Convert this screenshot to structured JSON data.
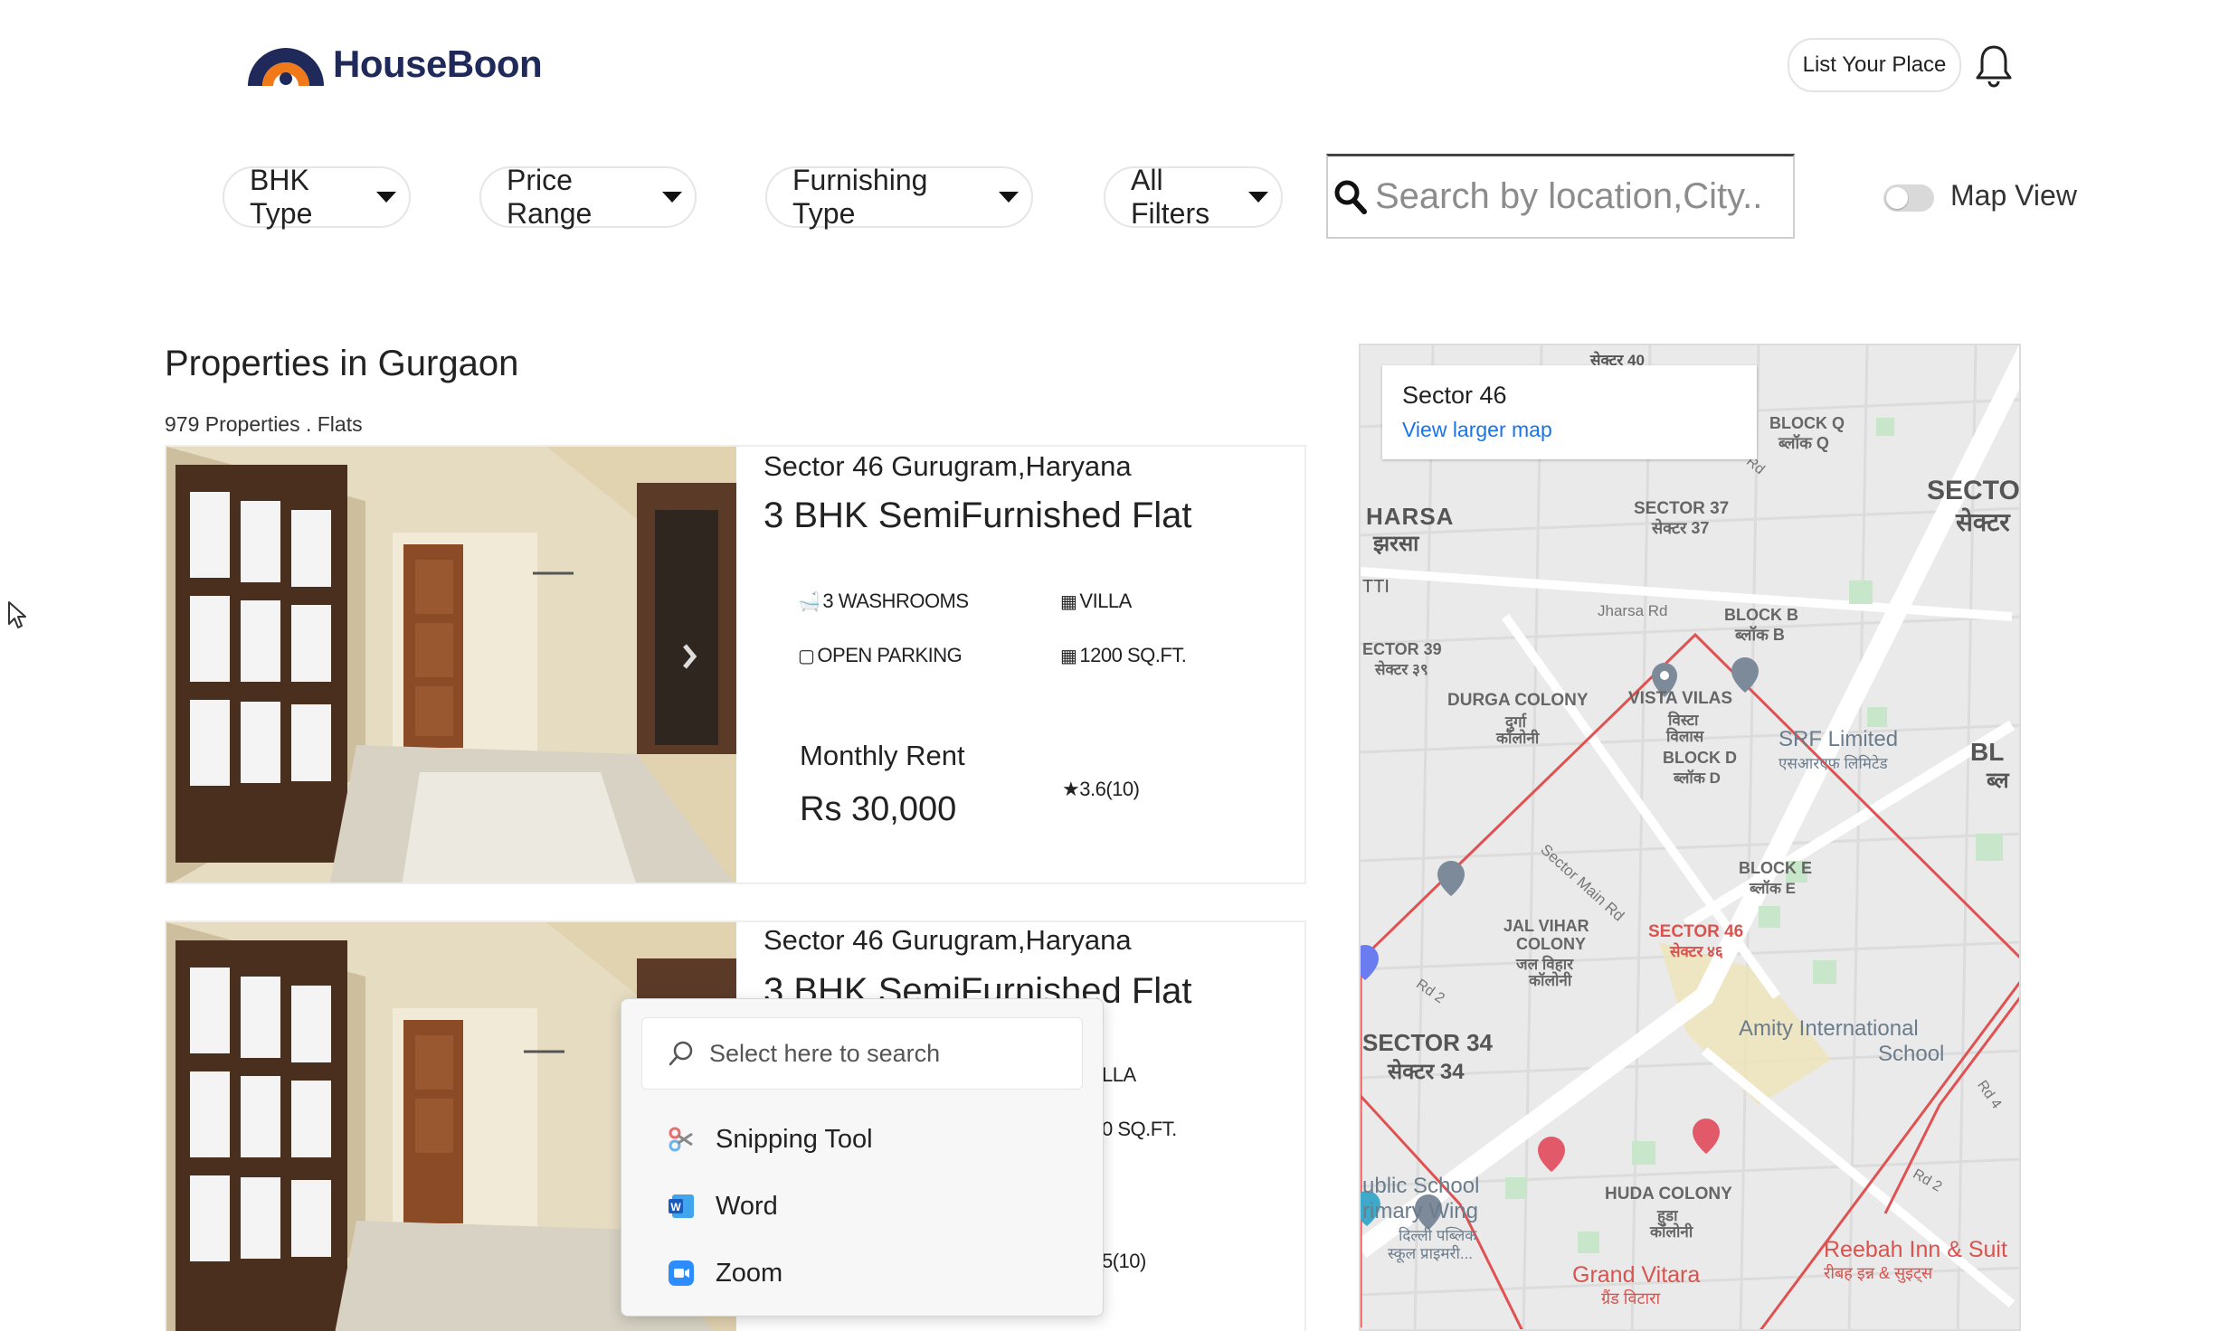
{
  "brand": {
    "name": "HouseBoon"
  },
  "header": {
    "list_place": "List Your Place"
  },
  "filters": [
    {
      "label": "BHK Type"
    },
    {
      "label": "Price Range"
    },
    {
      "label": "Furnishing Type"
    },
    {
      "label": "All Filters"
    }
  ],
  "search": {
    "placeholder": "Search by location,City.."
  },
  "map_toggle": {
    "label": "Map View",
    "enabled": false
  },
  "listing": {
    "title": "Properties in Gurgaon",
    "subtitle": "979 Properties . Flats"
  },
  "cards": [
    {
      "location": "Sector 46 Gurugram,Haryana",
      "title": "3 BHK SemiFurnished Flat",
      "features": [
        "3 WASHROOMS",
        "VILLA",
        "OPEN PARKING",
        "1200 SQ.FT."
      ],
      "rent_label": "Monthly Rent",
      "rent": "Rs 30,000",
      "rating": "3.6(10)"
    },
    {
      "location": "Sector 46 Gurugram,Haryana",
      "title": "3 BHK SemiFurnished Flat",
      "features": [
        "LLA",
        "0 SQ.FT."
      ],
      "rating": "5(10)"
    }
  ],
  "map": {
    "info_title": "Sector 46",
    "info_link": "View larger map",
    "labels": {
      "sector40": "सेक्टर 40",
      "harsa": "HARSA",
      "harsa_hi": "झरसा",
      "tti": "TTI",
      "blockq": "BLOCK Q",
      "blockq_hi": "ब्लॉक Q",
      "sector37": "SECTOR 37",
      "sector37_hi": "सेक्टर 37",
      "secto": "SECTO",
      "secto_hi": "सेक्टर",
      "jharsa_rd": "Jharsa Rd",
      "blockb": "BLOCK B",
      "blockb_hi": "ब्लॉक B",
      "sector39": "ECTOR 39",
      "sector39_hi": "सेक्टर ३९",
      "durga": "DURGA COLONY",
      "durga_hi1": "दुर्गा",
      "durga_hi2": "कॉलोनी",
      "vista": "VISTA VILAS",
      "vista_hi1": "विस्टा",
      "vista_hi2": "विलास",
      "blockd": "BLOCK D",
      "blockd_hi": "ब्लॉक D",
      "srf": "SRF Limited",
      "srf_hi": "एसआरएफ लिमिटेड",
      "bl": "BL",
      "bl_hi": "ब्ल",
      "sector_main": "Sector Main Rd",
      "blocke": "BLOCK E",
      "blocke_hi": "ब्लॉक E",
      "jalvihar": "JAL VIHAR",
      "colony": "COLONY",
      "jalvihar_hi": "जल विहार",
      "jalvihar_hi2": "कॉलोनी",
      "sector46": "SECTOR 46",
      "sector46_hi": "सेक्टर ४६",
      "rd2": "Rd 2",
      "sector34": "SECTOR 34",
      "sector34_hi": "सेक्टर 34",
      "amity": "Amity International",
      "school": "School",
      "rd4": "Rd 4",
      "public": "ublic School",
      "primary": "rimary Wing",
      "public_hi1": "दिल्ली पब्लिक",
      "public_hi2": "स्कूल प्राइमरी...",
      "huda": "HUDA COLONY",
      "huda_hi1": "हुडा",
      "huda_hi2": "कॉलोनी",
      "rd2b": "Rd 2",
      "grand": "Grand Vitara",
      "grand_hi": "ग्रैंड विटारा",
      "reebah": "Reebah Inn & Suit",
      "reebah_hi": "रीबह इन्न & सुइट्स",
      "rd": "Rd"
    }
  },
  "popup": {
    "search_placeholder": "Select here to search",
    "items": [
      {
        "label": "Snipping Tool",
        "icon": "snipping-tool-icon"
      },
      {
        "label": "Word",
        "icon": "word-icon"
      },
      {
        "label": "Zoom",
        "icon": "zoom-icon"
      }
    ]
  },
  "colors": {
    "brand_navy": "#1f2a5a",
    "brand_orange": "#f07a1a",
    "map_link": "#1a73e8",
    "route": "#e05252"
  }
}
